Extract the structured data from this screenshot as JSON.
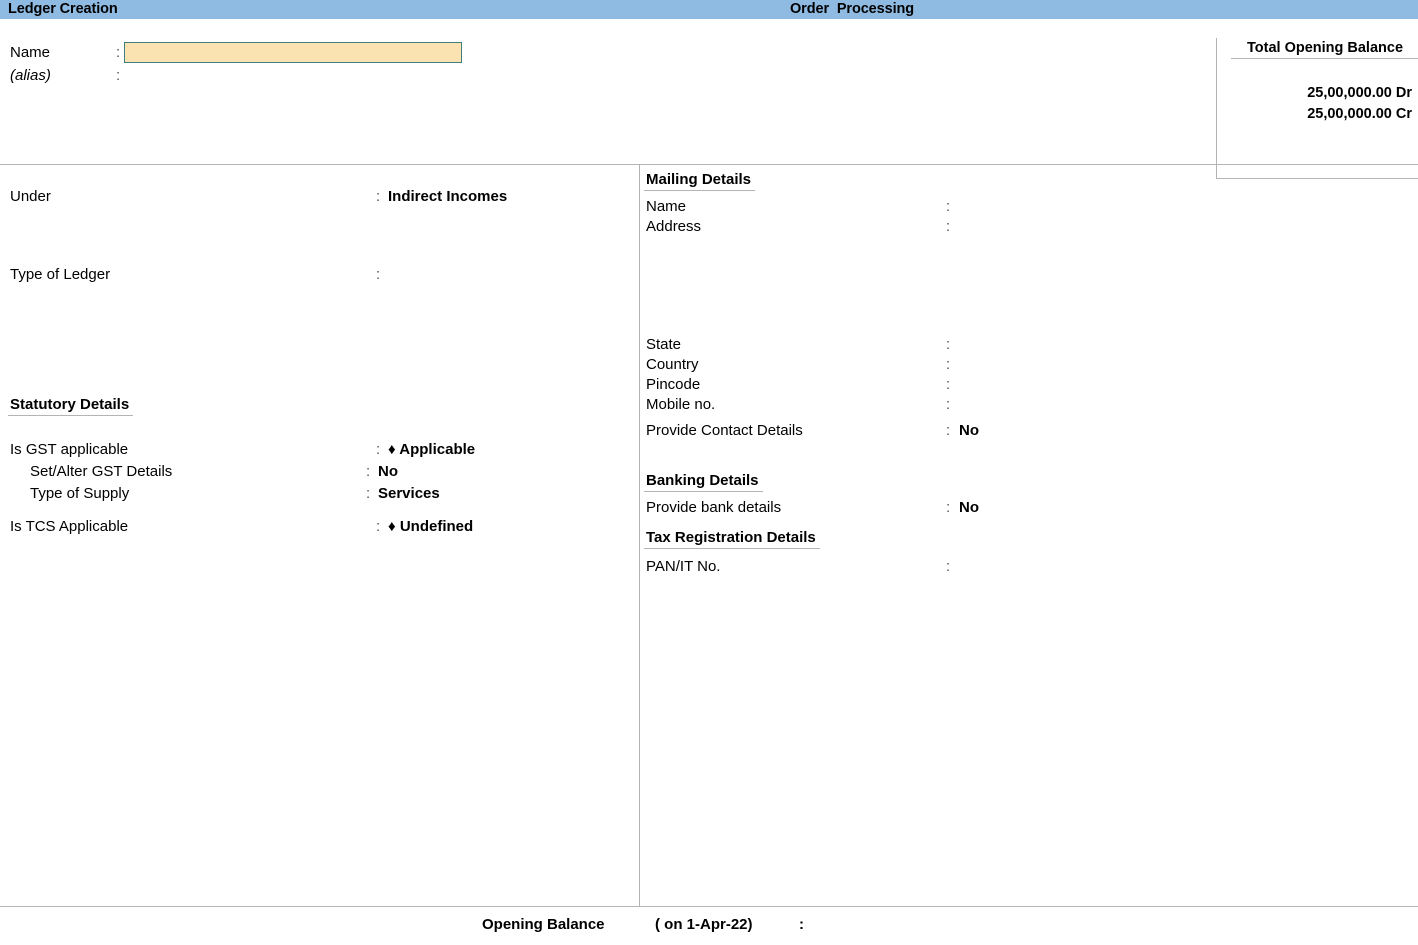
{
  "titlebar": {
    "left_title": "Ledger Creation",
    "center_title": "Order  Processing"
  },
  "name_block": {
    "name_label": "Name",
    "name_colon": ":",
    "name_value": "",
    "name_placeholder": "",
    "alias_label": "(alias)",
    "alias_colon": ":",
    "alias_value": ""
  },
  "total_opening_balance": {
    "title": "Total Opening Balance",
    "debit": "25,00,000.00 Dr",
    "credit": "25,00,000.00 Cr"
  },
  "left_pane": {
    "under": {
      "label": "Under",
      "colon": ":",
      "value": "Indirect Incomes"
    },
    "type_of_ledger": {
      "label": "Type of Ledger",
      "colon": ":",
      "value": ""
    },
    "statutory_heading": "Statutory Details",
    "is_gst_applicable": {
      "label": "Is GST applicable",
      "colon": ":",
      "value": "♦ Applicable"
    },
    "set_alter_gst": {
      "label": "Set/Alter GST Details",
      "colon": ":",
      "value": "No"
    },
    "type_of_supply": {
      "label": "Type of Supply",
      "colon": ":",
      "value": "Services"
    },
    "is_tcs_applicable": {
      "label": "Is TCS Applicable",
      "colon": ":",
      "value": "♦ Undefined"
    }
  },
  "right_pane": {
    "mailing_heading": "Mailing Details",
    "mail_name": {
      "label": "Name",
      "colon": ":",
      "value": ""
    },
    "mail_address": {
      "label": "Address",
      "colon": ":",
      "value": ""
    },
    "state": {
      "label": "State",
      "colon": ":",
      "value": ""
    },
    "country": {
      "label": "Country",
      "colon": ":",
      "value": ""
    },
    "pincode": {
      "label": "Pincode",
      "colon": ":",
      "value": ""
    },
    "mobile_no": {
      "label": "Mobile no.",
      "colon": ":",
      "value": ""
    },
    "provide_contact_details": {
      "label": "Provide Contact Details",
      "colon": ":",
      "value": "No"
    },
    "banking_heading": "Banking Details",
    "provide_bank_details": {
      "label": "Provide bank details",
      "colon": ":",
      "value": "No"
    },
    "tax_heading": "Tax Registration Details",
    "pan_it_no": {
      "label": "PAN/IT No.",
      "colon": ":",
      "value": ""
    }
  },
  "footer": {
    "opening_balance_label": "Opening Balance",
    "as_on": "( on 1-Apr-22)",
    "colon": ":",
    "value": ""
  },
  "colors": {
    "titlebar_blue": "#8fbbe3",
    "input_fill": "#fae3b1",
    "input_border": "#3f7f7f",
    "rule_gray": "#b4b4b4"
  }
}
